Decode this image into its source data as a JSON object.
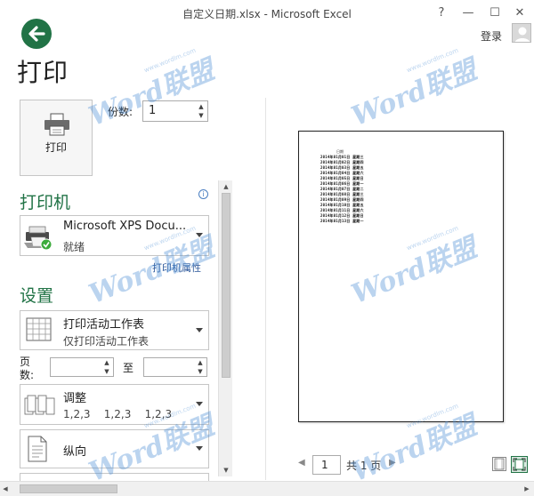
{
  "window": {
    "title": "自定义日期.xlsx - Microsoft Excel",
    "help": "?",
    "minimize": "—",
    "maximize": "☐",
    "close": "✕",
    "login": "登录"
  },
  "page_title": "打印",
  "print": {
    "button_label": "打印",
    "copies_label": "份数:",
    "copies_value": "1"
  },
  "printer": {
    "section_title": "打印机",
    "name": "Microsoft XPS Docu...",
    "status": "就绪",
    "properties_link": "打印机属性",
    "info": "i"
  },
  "settings": {
    "section_title": "设置",
    "sheet_main": "打印活动工作表",
    "sheet_sub": "仅打印活动工作表",
    "pages_label": "页数:",
    "to_label": "至",
    "collate_main": "调整",
    "collate_sub": "1,2,3    1,2,3    1,2,3",
    "orientation_main": "纵向"
  },
  "preview": {
    "header_text": "日期",
    "lines": [
      "2014年01月01日 星期三",
      "2014年01月02日 星期四",
      "2014年01月03日 星期五",
      "2014年01月04日 星期六",
      "2014年01月05日 星期日",
      "2014年01月06日 星期一",
      "2014年01月07日 星期二",
      "2014年01月08日 星期三",
      "2014年01月09日 星期四",
      "2014年01月10日 星期五",
      "2014年01月11日 星期六",
      "2014年01月12日 星期日",
      "2014年01月13日 星期一"
    ],
    "current_page": "1",
    "page_total": "共 1 页"
  },
  "watermark": {
    "text": "Word联盟",
    "url": "www.wordlm.com"
  },
  "colors": {
    "accent": "#217346",
    "link": "#2b579a"
  }
}
